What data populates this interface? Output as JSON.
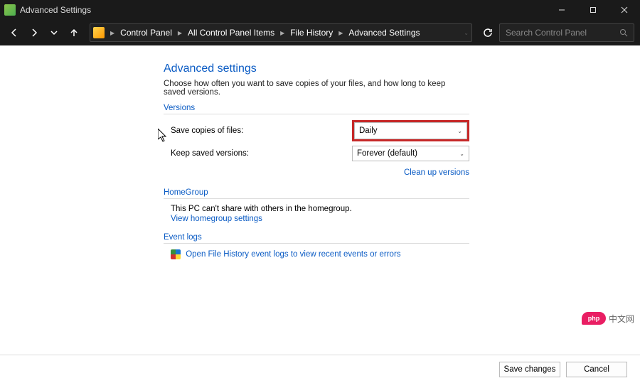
{
  "titlebar": {
    "title": "Advanced Settings"
  },
  "breadcrumbs": {
    "items": [
      "Control Panel",
      "All Control Panel Items",
      "File History",
      "Advanced Settings"
    ]
  },
  "search": {
    "placeholder": "Search Control Panel"
  },
  "page": {
    "title": "Advanced settings",
    "desc": "Choose how often you want to save copies of your files, and how long to keep saved versions."
  },
  "versions": {
    "label": "Versions",
    "save_copies_label": "Save copies of files:",
    "save_copies_value": "Daily",
    "keep_versions_label": "Keep saved versions:",
    "keep_versions_value": "Forever (default)",
    "cleanup_link": "Clean up versions"
  },
  "homegroup": {
    "label": "HomeGroup",
    "text": "This PC can't share with others in the homegroup.",
    "link": "View homegroup settings"
  },
  "eventlogs": {
    "label": "Event logs",
    "link": "Open File History event logs to view recent events or errors"
  },
  "footer": {
    "save": "Save changes",
    "cancel": "Cancel"
  },
  "watermark": {
    "brand": "php",
    "text": "中文网"
  }
}
